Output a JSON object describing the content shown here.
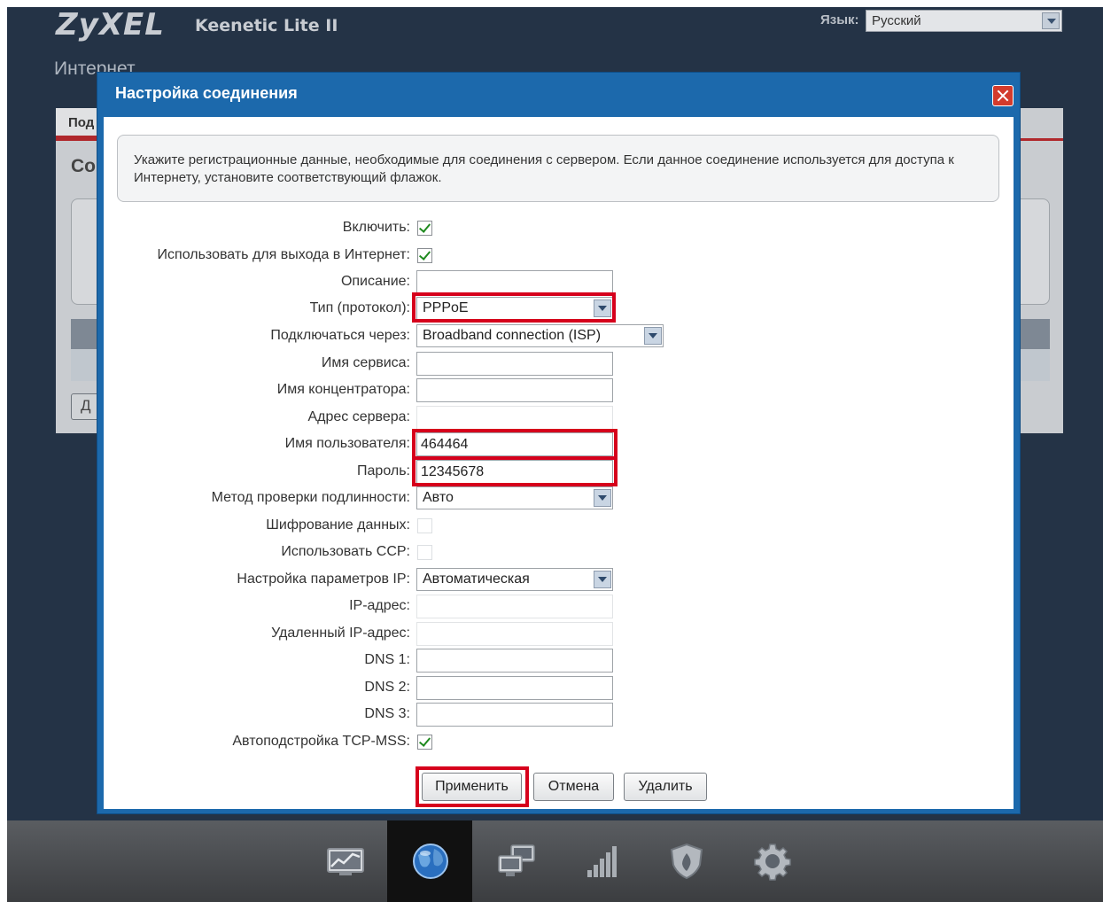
{
  "header": {
    "brand": "ZyXEL",
    "model": "Keenetic Lite II",
    "language_label": "Язык:",
    "language_value": "Русский"
  },
  "background_page": {
    "title": "Интернет",
    "tab_label": "Под",
    "heading": "Со",
    "button_label": "Д"
  },
  "dialog": {
    "title": "Настройка соединения",
    "info_text": "Укажите регистрационные данные, необходимые для соединения с сервером. Если данное соединение используется для доступа к Интернету, установите соответствующий флажок.",
    "fields": {
      "enable": {
        "label": "Включить:",
        "checked": true
      },
      "use_internet": {
        "label": "Использовать для выхода в Интернет:",
        "checked": true
      },
      "description": {
        "label": "Описание:",
        "value": ""
      },
      "protocol": {
        "label": "Тип (протокол):",
        "value": "PPPoE"
      },
      "connect_via": {
        "label": "Подключаться через:",
        "value": "Broadband connection (ISP)"
      },
      "service_name": {
        "label": "Имя сервиса:",
        "value": ""
      },
      "concentrator_name": {
        "label": "Имя концентратора:",
        "value": ""
      },
      "server_address": {
        "label": "Адрес сервера:",
        "value": ""
      },
      "username": {
        "label": "Имя пользователя:",
        "value": "464464"
      },
      "password": {
        "label": "Пароль:",
        "value": "12345678"
      },
      "auth_method": {
        "label": "Метод проверки подлинности:",
        "value": "Авто"
      },
      "encryption": {
        "label": "Шифрование данных:",
        "checked": false
      },
      "use_ccp": {
        "label": "Использовать CCP:",
        "checked": false
      },
      "ip_settings": {
        "label": "Настройка параметров IP:",
        "value": "Автоматическая"
      },
      "ip_address": {
        "label": "IP-адрес:",
        "value": ""
      },
      "remote_ip": {
        "label": "Удаленный IP-адрес:",
        "value": ""
      },
      "dns1": {
        "label": "DNS 1:",
        "value": ""
      },
      "dns2": {
        "label": "DNS 2:",
        "value": ""
      },
      "dns3": {
        "label": "DNS 3:",
        "value": ""
      },
      "tcp_mss": {
        "label": "Автоподстройка TCP-MSS:",
        "checked": true
      }
    },
    "buttons": {
      "apply": "Применить",
      "cancel": "Отмена",
      "delete": "Удалить"
    }
  },
  "taskbar": {
    "items": [
      {
        "icon": "monitor-chart-icon",
        "active": false
      },
      {
        "icon": "globe-icon",
        "active": true
      },
      {
        "icon": "network-computers-icon",
        "active": false
      },
      {
        "icon": "signal-bars-icon",
        "active": false
      },
      {
        "icon": "shield-icon",
        "active": false
      },
      {
        "icon": "gear-icon",
        "active": false
      }
    ]
  },
  "colors": {
    "highlight": "#d6001c",
    "dialog_frame": "#1c69ac",
    "page_background": "#243346"
  }
}
